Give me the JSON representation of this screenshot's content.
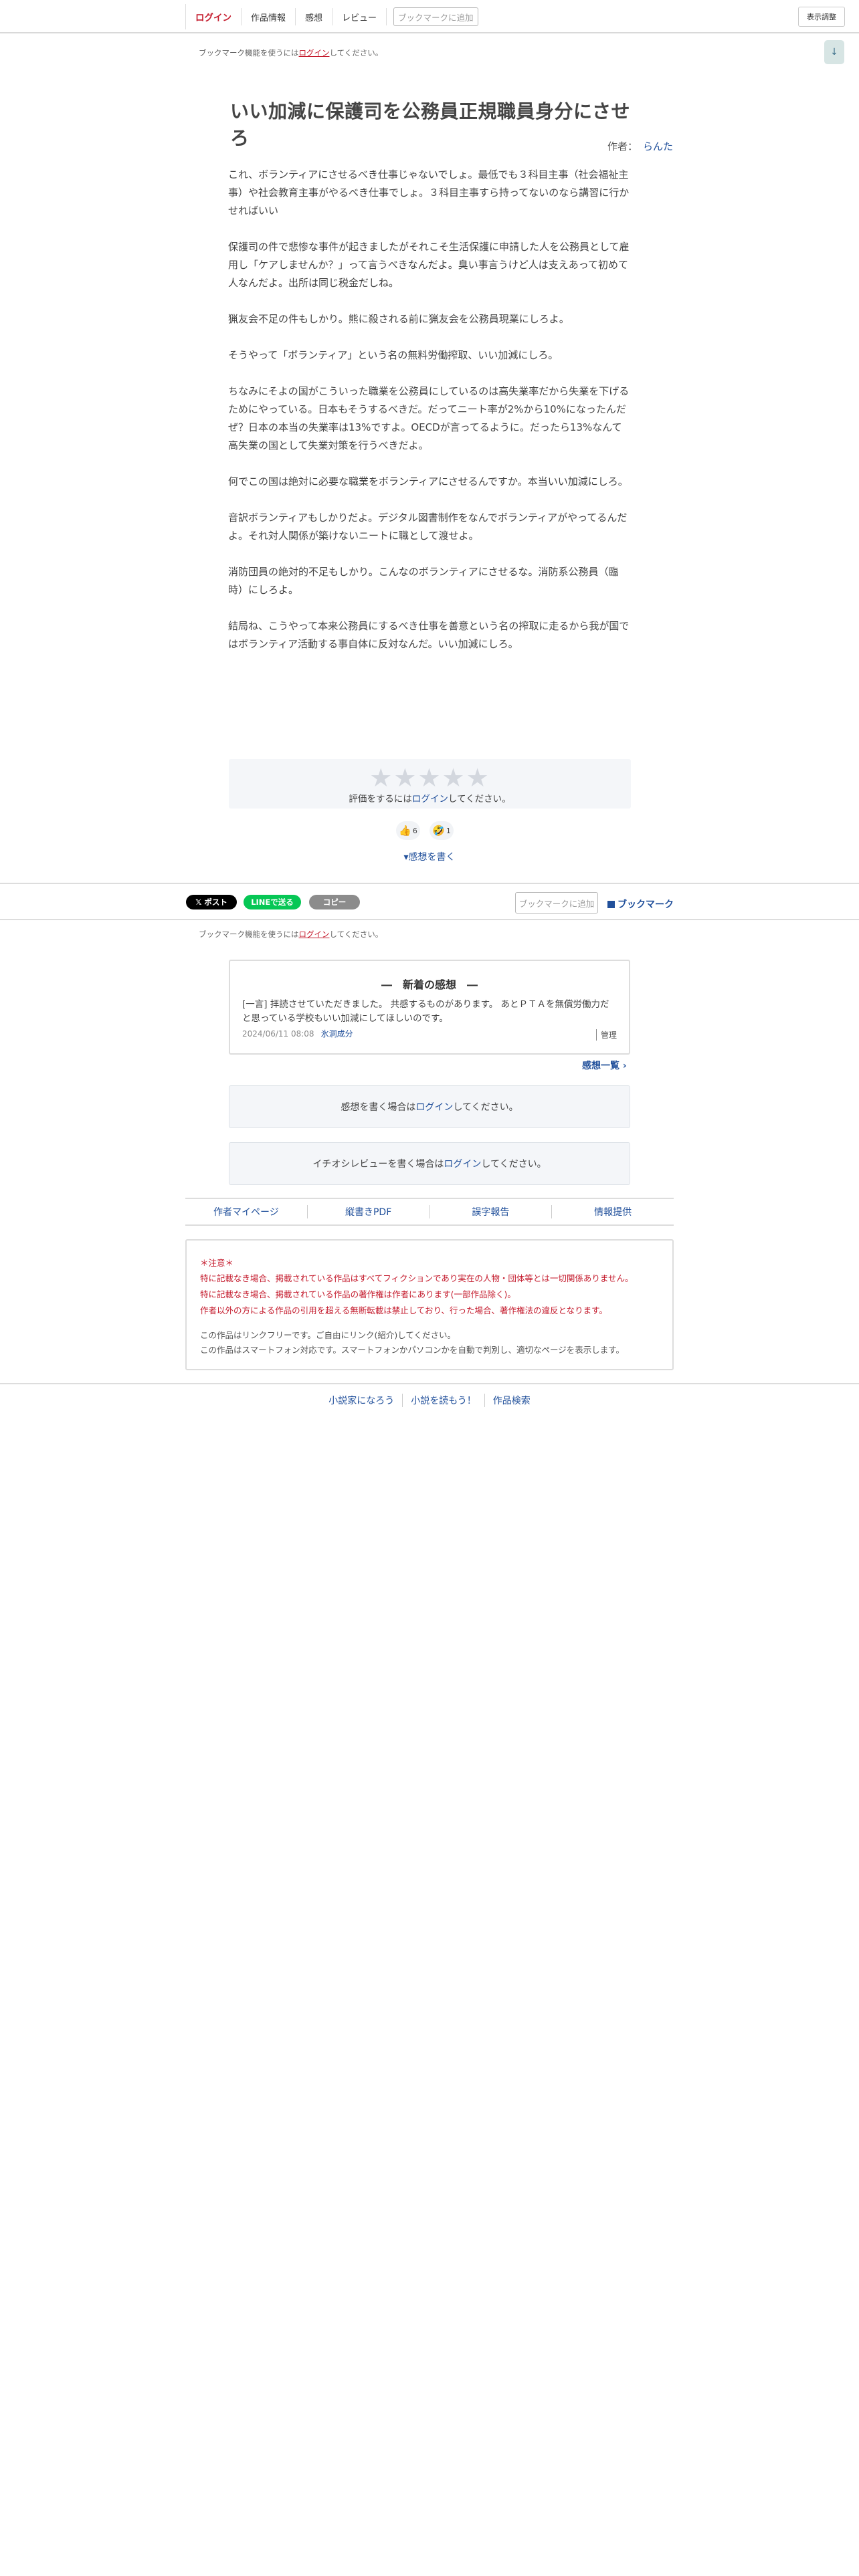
{
  "topnav": {
    "login": "ログイン",
    "work_info": "作品情報",
    "impressions": "感想",
    "review": "レビュー",
    "bookmark_add": "ブックマークに追加",
    "display_adjust": "表示調整"
  },
  "bookmark_notice": {
    "prefix": "ブックマーク機能を使うには",
    "link": "ログイン",
    "suffix": "してください。"
  },
  "scroll_down_icon": "↓",
  "work": {
    "title": "いい加減に保護司を公務員正規職員身分にさせろ",
    "author_label": "作者：",
    "author_name": "らんた",
    "paragraphs": [
      "これ、ボランティアにさせるべき仕事じゃないでしょ。最低でも３科目主事（社会福祉主事）や社会教育主事がやるべき仕事でしょ。３科目主事すら持ってないのなら講習に行かせればいい",
      "保護司の件で悲惨な事件が起きましたがそれこそ生活保護に申請した人を公務員として雇用し「ケアしませんか？」って言うべきなんだよ。臭い事言うけど人は支えあって初めて人なんだよ。出所は同じ税金だしね。",
      "猟友会不足の件もしかり。熊に殺される前に猟友会を公務員現業にしろよ。",
      "そうやって「ボランティア」という名の無料労働搾取、いい加減にしろ。",
      "ちなみにそよの国がこういった職業を公務員にしているのは高失業率だから失業を下げるためにやっている。日本もそうするべきだ。だってニート率が2%から10%になったんだぜ？日本の本当の失業率は13%ですよ。OECDが言ってるように。だったら13%なんて高失業の国として失業対策を行うべきだよ。",
      "何でこの国は絶対に必要な職業をボランティアにさせるんですか。本当いい加減にしろ。",
      "音訳ボランティアもしかりだよ。デジタル図書制作をなんでボランティアがやってるんだよ。それ対人関係が築けないニートに職として渡せよ。",
      "消防団員の絶対的不足もしかり。こんなのボランティアにさせるな。消防系公務員（臨時）にしろよ。",
      "結局ね、こうやって本来公務員にするべき仕事を善意という名の搾取に走るから我が国ではボランティア活動する事自体に反対なんだ。いい加減にしろ。"
    ]
  },
  "rating": {
    "star_glyph": "★",
    "stars": [
      1,
      2,
      3,
      4,
      5
    ],
    "prefix": "評価をするには",
    "link": "ログイン",
    "suffix": "してください。"
  },
  "reactions": [
    {
      "icon": "thumbs-up",
      "emoji": "👍",
      "count": "6"
    },
    {
      "icon": "laughing-face",
      "emoji": "🤣",
      "count": "1"
    }
  ],
  "write_impression": "▾感想を書く",
  "share": {
    "post": "𝕏 ポスト",
    "line": "LINEで送る",
    "copy": "コピー",
    "bookmark_add": "ブックマークに追加",
    "bookmark": "ブックマーク"
  },
  "recent_impressions": {
    "heading": "―　新着の感想　―",
    "text": "[一言] 拝読させていただきました。 共感するものがあります。 あとＰＴＡを無償労働力だと思っている学校もいい加減にしてほしいのです。",
    "date": "2024/06/11 08:08",
    "user": "氷洞成分",
    "manage": "管理"
  },
  "impression_list": "感想一覧 ›",
  "impression_login": {
    "prefix": "感想を書く場合は",
    "link": "ログイン",
    "suffix": "してください。"
  },
  "review_login": {
    "prefix": "イチオシレビューを書く場合は",
    "link": "ログイン",
    "suffix": "してください。"
  },
  "footer_links": [
    "作者マイページ",
    "縦書きPDF",
    "誤字報告",
    "情報提供"
  ],
  "notice": {
    "heading": "＊注意＊",
    "red_lines": [
      "特に記載なき場合、掲載されている作品はすべてフィクションであり実在の人物・団体等とは一切関係ありません。",
      "特に記載なき場合、掲載されている作品の著作権は作者にあります(一部作品除く)。",
      "作者以外の方による作品の引用を超える無断転載は禁止しており、行った場合、著作権法の違反となります。"
    ],
    "gray_lines": [
      "この作品はリンクフリーです。ご自由にリンク(紹介)してください。",
      "この作品はスマートフォン対応です。スマートフォンかパソコンかを自動で判別し、適切なページを表示します。"
    ]
  },
  "bottom_links": [
    "小説家になろう",
    "小説を読もう！",
    "作品検索"
  ],
  "colors": {
    "accent_red": "#c4192b",
    "link_blue": "#21509b",
    "line_green": "#06c755"
  }
}
